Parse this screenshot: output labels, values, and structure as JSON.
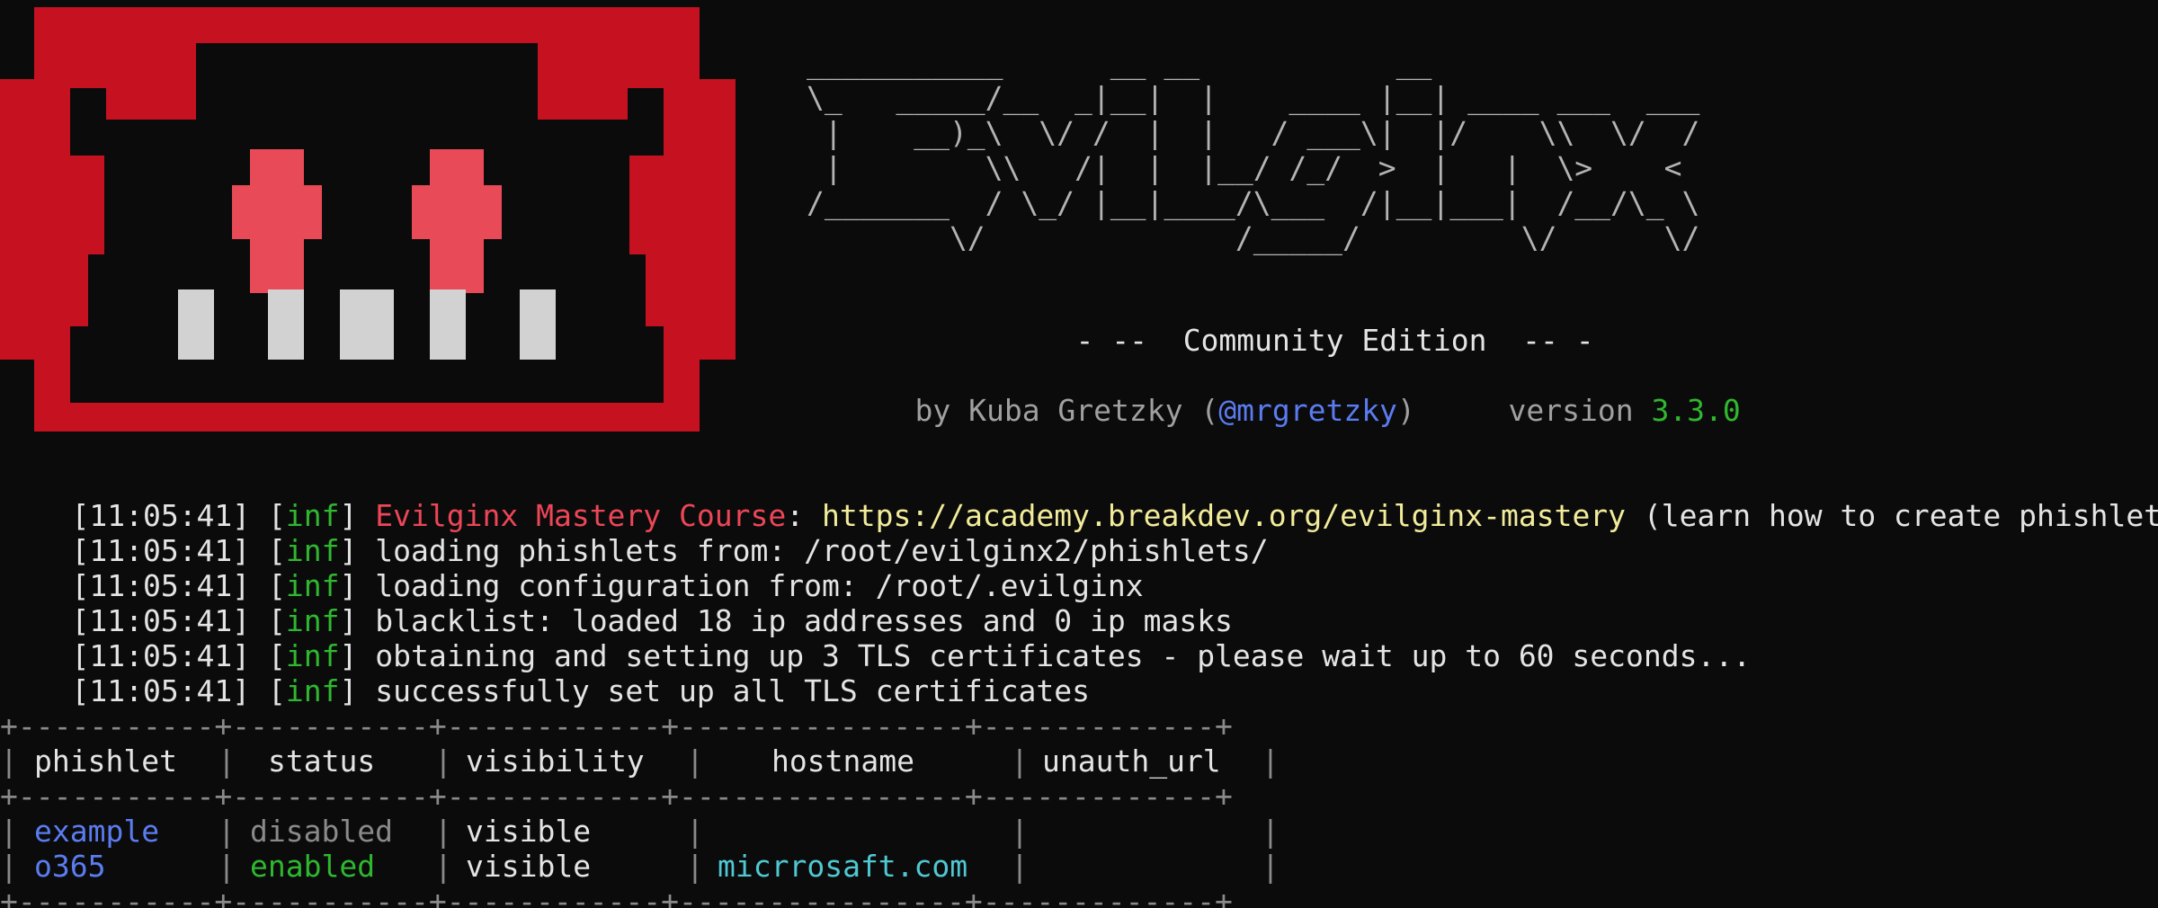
{
  "banner": {
    "ascii_logo": "___________      __ __           __\n\\_   _____/__  _|__|  |    ____ |__| ____ ___  ___\n |    __)_\\  \\/ /  |  |   / ___\\|  |/    \\\\  \\/  /\n |        \\\\   /|  |  |__/ /_/  >  |   |  \\>    <\n/_______  / \\_/ |__|____/\\___  /|__|___|  /__/\\_ \\\n        \\/              /_____/         \\/      \\/",
    "edition_line": "- --  Community Edition  -- -",
    "author_prefix": "by Kuba Gretzky (",
    "author_handle": "@mrgretzky",
    "author_suffix": ")",
    "version_label": "version",
    "version_number": "3.3.0"
  },
  "colors": {
    "mascot_red": "#c61121",
    "mascot_eye": "#e84a57",
    "mascot_teeth": "#d2d2d2",
    "info_green": "#2fb82f",
    "link_blue": "#5b7cf0",
    "course_red": "#ec4657",
    "url_yellow": "#f2ec9a",
    "hostname_cyan": "#4fc8d2"
  },
  "log": [
    {
      "time": "[11:05:41]",
      "level": "inf",
      "label": "Evilginx Mastery Course",
      "sep": ": ",
      "url": "https://academy.breakdev.org/evilginx-mastery",
      "message": " (learn how to create phishlets)"
    },
    {
      "time": "[11:05:41]",
      "level": "inf",
      "message": "loading phishlets from: /root/evilginx2/phishlets/"
    },
    {
      "time": "[11:05:41]",
      "level": "inf",
      "message": "loading configuration from: /root/.evilginx"
    },
    {
      "time": "[11:05:41]",
      "level": "inf",
      "message": "blacklist: loaded 18 ip addresses and 0 ip masks"
    },
    {
      "time": "[11:05:41]",
      "level": "inf",
      "message": "obtaining and setting up 3 TLS certificates - please wait up to 60 seconds..."
    },
    {
      "time": "[11:05:41]",
      "level": "inf",
      "message": "successfully set up all TLS certificates"
    }
  ],
  "table": {
    "separator": "+-----------+-----------+------------+----------------+-------------+",
    "pipe": "|",
    "headers": [
      "phishlet",
      "status",
      "visibility",
      "hostname",
      "unauth_url"
    ],
    "rows": [
      {
        "phishlet": "example",
        "status": "disabled",
        "visibility": "visible",
        "hostname": "",
        "unauth_url": ""
      },
      {
        "phishlet": "o365",
        "status": "enabled",
        "visibility": "visible",
        "hostname": "micrrosaft.com",
        "unauth_url": ""
      }
    ]
  }
}
